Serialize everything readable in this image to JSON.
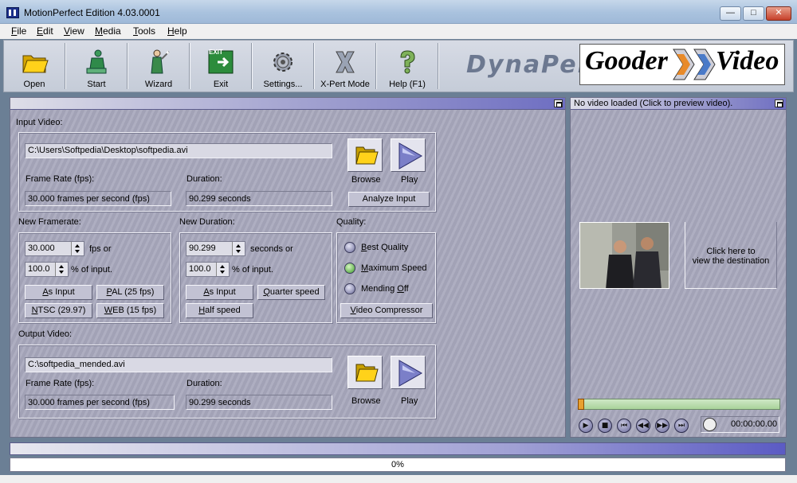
{
  "window": {
    "title": "MotionPerfect Edition 4.03.0001",
    "minimize": "—",
    "maximize": "□",
    "close": "✕"
  },
  "menu": [
    {
      "first": "F",
      "rest": "ile"
    },
    {
      "first": "E",
      "rest": "dit"
    },
    {
      "first": "V",
      "rest": "iew"
    },
    {
      "first": "M",
      "rest": "edia"
    },
    {
      "first": "T",
      "rest": "ools"
    },
    {
      "first": "H",
      "rest": "elp"
    }
  ],
  "toolbar": {
    "open": "Open",
    "start": "Start",
    "wizard": "Wizard",
    "exit": "Exit",
    "settings": "Settings...",
    "xpert": "X-Pert Mode",
    "help": "Help (F1)",
    "exit_sign": "EXIT"
  },
  "brand": {
    "dynapel": "DynaPel",
    "gooder": "Gooder",
    "video": "Video"
  },
  "input": {
    "section_label": "Input Video:",
    "path": "C:\\Users\\Softpedia\\Desktop\\softpedia.avi",
    "frame_rate_label": "Frame Rate (fps):",
    "frame_rate_value": "30.000 frames per second (fps)",
    "duration_label": "Duration:",
    "duration_value": "90.299 seconds",
    "browse": "Browse",
    "play": "Play",
    "analyze": "Analyze Input"
  },
  "framerate": {
    "label": "New Framerate:",
    "fps_value": "30.000",
    "fps_suffix": "fps or",
    "pct_value": "100.0",
    "pct_suffix": "% of input.",
    "as_input": {
      "u": "A",
      "rest": "s Input"
    },
    "pal": {
      "u": "P",
      "rest": "AL (25 fps)"
    },
    "ntsc": {
      "u": "N",
      "rest": "TSC (29.97)"
    },
    "web": {
      "u": "W",
      "rest": "EB (15 fps)"
    }
  },
  "duration": {
    "label": "New Duration:",
    "sec_value": "90.299",
    "sec_suffix": "seconds or",
    "pct_value": "100.0",
    "pct_suffix": "% of input.",
    "as_input": {
      "u": "A",
      "rest": "s Input"
    },
    "quarter": {
      "u": "Q",
      "rest": "uarter speed"
    },
    "half": {
      "u": "H",
      "rest": "alf speed"
    }
  },
  "quality": {
    "label": "Quality:",
    "options": [
      {
        "u": "B",
        "rest": "est Quality",
        "selected": false
      },
      {
        "u": "M",
        "rest": "aximum Speed",
        "selected": true
      },
      {
        "u": "",
        "rest": "Mending ",
        "u2": "O",
        "rest2": "ff",
        "selected": false
      }
    ],
    "compressor": {
      "u": "V",
      "rest": "ideo Compressor"
    }
  },
  "output": {
    "section_label": "Output Video:",
    "path": "C:\\softpedia_mended.avi",
    "frame_rate_label": "Frame Rate (fps):",
    "frame_rate_value": "30.000 frames per second (fps)",
    "duration_label": "Duration:",
    "duration_value": "90.299 seconds",
    "browse": "Browse",
    "play": "Play"
  },
  "preview": {
    "header": "No video loaded (Click to preview video).",
    "dest_text": "Click here to\nview the destination video",
    "time": "00:00:00.00",
    "controls": [
      "play-icon",
      "stop-icon",
      "skip-start-icon",
      "rewind-icon",
      "fast-forward-icon",
      "skip-end-icon"
    ]
  },
  "progress": {
    "value": 0,
    "text": "0%"
  },
  "colors": {
    "panel": "#a9a9bd",
    "header_accent": "#6e6ec2",
    "selected_radio": "#3b9a2a"
  }
}
